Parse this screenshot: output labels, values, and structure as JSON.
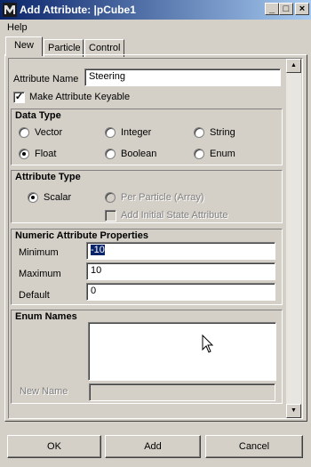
{
  "window": {
    "title": "Add Attribute: |pCube1",
    "icon": "maya-icon",
    "buttons": {
      "minimize": "_",
      "maximize": "□",
      "close": "×"
    }
  },
  "menu": {
    "items": [
      "Help"
    ]
  },
  "tabs": [
    {
      "label": "New",
      "active": true
    },
    {
      "label": "Particle",
      "active": false
    },
    {
      "label": "Control",
      "active": false
    }
  ],
  "form": {
    "attribute_name_label": "Attribute Name",
    "attribute_name_value": "Steering",
    "make_keyable_label": "Make Attribute Keyable",
    "make_keyable_checked": true
  },
  "data_type": {
    "title": "Data Type",
    "options": [
      "Vector",
      "Integer",
      "String",
      "Float",
      "Boolean",
      "Enum"
    ],
    "selected": "Float"
  },
  "attribute_type": {
    "title": "Attribute Type",
    "scalar_label": "Scalar",
    "per_particle_label": "Per Particle (Array)",
    "initial_state_label": "Add Initial State Attribute",
    "selected": "Scalar"
  },
  "numeric": {
    "title": "Numeric Attribute Properties",
    "minimum_label": "Minimum",
    "minimum_value": "-10",
    "maximum_label": "Maximum",
    "maximum_value": "10",
    "default_label": "Default",
    "default_value": "0"
  },
  "enum": {
    "title": "Enum Names",
    "new_name_label": "New Name",
    "new_name_value": ""
  },
  "footer": {
    "ok_label": "OK",
    "add_label": "Add",
    "cancel_label": "Cancel"
  },
  "colors": {
    "titlebar_start": "#0a246a",
    "titlebar_end": "#a6caf0",
    "face": "#d4d0c8"
  }
}
